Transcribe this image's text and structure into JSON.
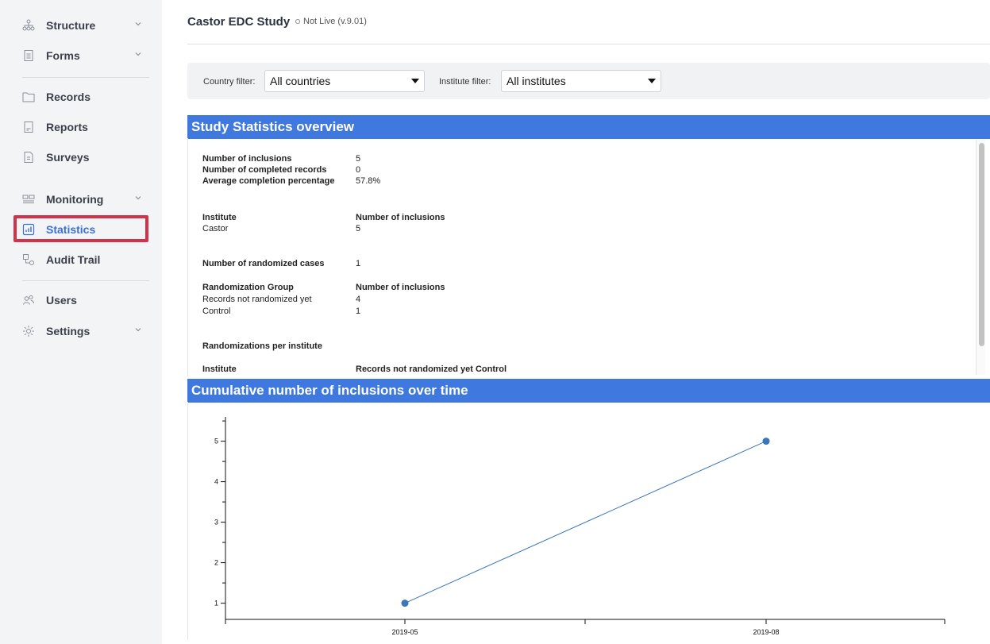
{
  "sidebar": {
    "items": [
      {
        "label": "Structure",
        "icon": "structure-icon",
        "has_chevron": true
      },
      {
        "label": "Forms",
        "icon": "forms-icon",
        "has_chevron": true
      },
      {
        "label": "Records",
        "icon": "folder-icon",
        "has_chevron": false
      },
      {
        "label": "Reports",
        "icon": "report-icon",
        "has_chevron": false
      },
      {
        "label": "Surveys",
        "icon": "survey-icon",
        "has_chevron": false
      },
      {
        "label": "Monitoring",
        "icon": "monitoring-icon",
        "has_chevron": true
      },
      {
        "label": "Statistics",
        "icon": "statistics-icon",
        "has_chevron": false,
        "active": true
      },
      {
        "label": "Audit Trail",
        "icon": "audit-trail-icon",
        "has_chevron": false
      },
      {
        "label": "Users",
        "icon": "users-icon",
        "has_chevron": false
      },
      {
        "label": "Settings",
        "icon": "gear-icon",
        "has_chevron": true
      }
    ]
  },
  "header": {
    "title": "Castor EDC Study",
    "status": "Not Live (v.9.01)"
  },
  "filters": {
    "country_label": "Country filter:",
    "country_value": "All countries",
    "institute_label": "Institute filter:",
    "institute_value": "All institutes"
  },
  "stats_section": {
    "title": "Study Statistics overview",
    "summary": [
      {
        "label": "Number of inclusions",
        "value": "5"
      },
      {
        "label": "Number of completed records",
        "value": "0"
      },
      {
        "label": "Average completion percentage",
        "value": "57.8%"
      }
    ],
    "institute_table": {
      "headers": [
        "Institute",
        "Number of inclusions"
      ],
      "rows": [
        [
          "Castor",
          "5"
        ]
      ]
    },
    "randomized": {
      "label": "Number of randomized cases",
      "value": "1"
    },
    "randomization_table": {
      "headers": [
        "Randomization Group",
        "Number of inclusions"
      ],
      "rows": [
        [
          "Records not randomized yet",
          "4"
        ],
        [
          "Control",
          "1"
        ]
      ]
    },
    "per_institute_title": "Randomizations per institute",
    "per_institute_headers": [
      "Institute",
      "Records not randomized yet Control"
    ]
  },
  "chart_section": {
    "title": "Cumulative number of inclusions over time"
  },
  "colors": {
    "accent": "#3f79e0",
    "active_nav": "#3b6fd8",
    "highlight": "#d3324b",
    "series": "#3a76b8"
  },
  "chart_data": {
    "type": "line",
    "title": "",
    "xlabel": "",
    "ylabel": "",
    "x": [
      "2019-05",
      "2019-08"
    ],
    "series": [
      {
        "values": [
          1,
          5
        ]
      }
    ],
    "yticks": [
      1,
      2,
      3,
      4,
      5
    ],
    "ylim": [
      0.6,
      5.6
    ],
    "grid": false
  }
}
